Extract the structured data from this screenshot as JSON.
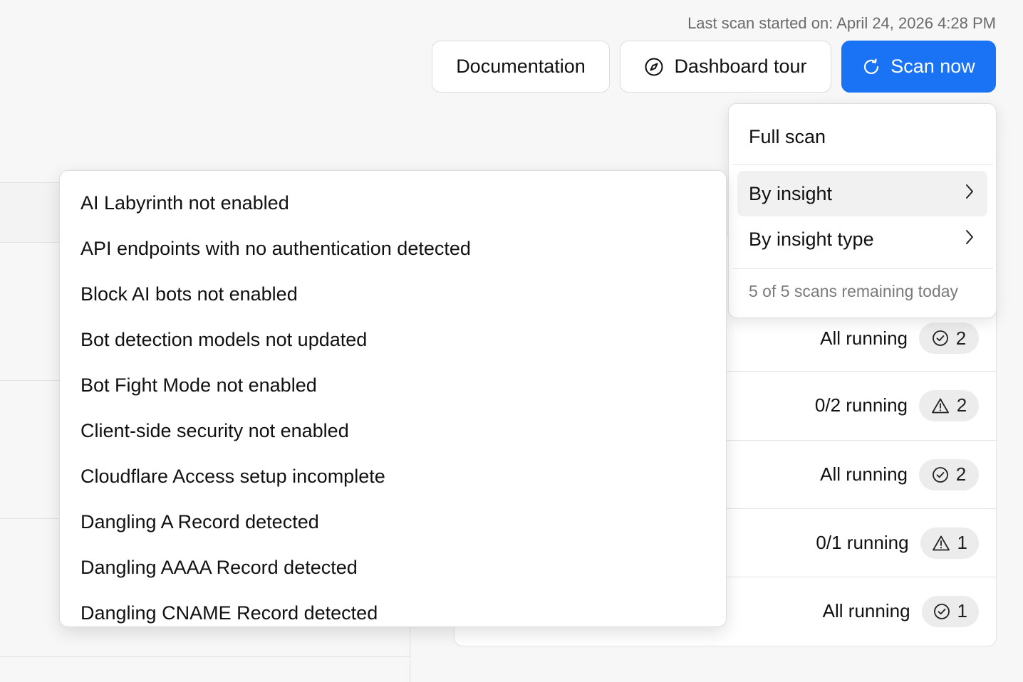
{
  "header": {
    "last_scan": "Last scan started on: April 24, 2026 4:28 PM",
    "documentation_label": "Documentation",
    "tour_label": "Dashboard tour",
    "scan_label": "Scan now"
  },
  "scan_menu": {
    "full_scan": "Full scan",
    "by_insight": "By insight",
    "by_insight_type": "By insight type",
    "remaining": "5 of 5 scans remaining today"
  },
  "insights": [
    "AI Labyrinth not enabled",
    "API endpoints with no authentication detected",
    "Block AI bots not enabled",
    "Bot detection models not updated",
    "Bot Fight Mode not enabled",
    "Client-side security not enabled",
    "Cloudflare Access setup incomplete",
    "Dangling A Record detected",
    "Dangling AAAA Record detected",
    "Dangling CNAME Record detected"
  ],
  "status_rows": [
    {
      "text": "All running",
      "icon": "check-circle-icon",
      "count": "2"
    },
    {
      "text": "0/2 running",
      "icon": "warning-triangle-icon",
      "count": "2"
    },
    {
      "text": "All running",
      "icon": "check-circle-icon",
      "count": "2"
    },
    {
      "text": "0/1 running",
      "icon": "warning-triangle-icon",
      "count": "1"
    },
    {
      "text": "All running",
      "icon": "check-circle-icon",
      "count": "1"
    }
  ],
  "colors": {
    "primary": "#1a73f5",
    "menu_hover": "#f1f1f1",
    "pill_bg": "#ececec"
  }
}
